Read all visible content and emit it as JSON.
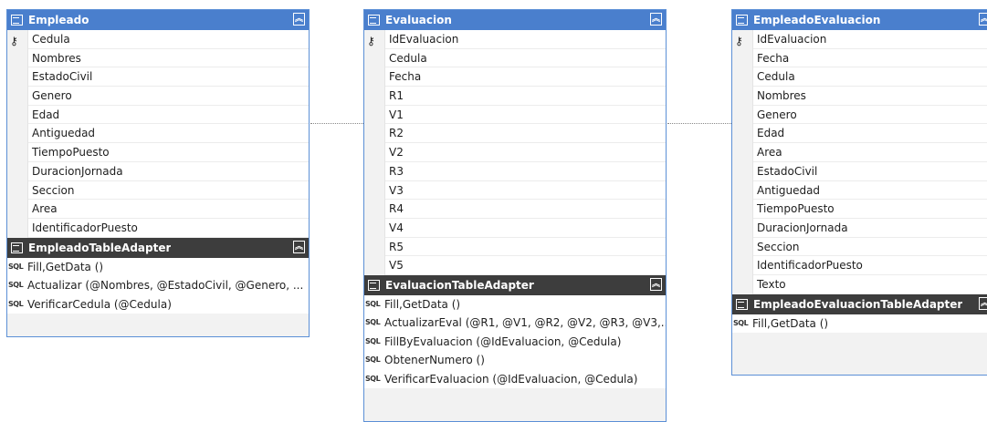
{
  "tables": [
    {
      "name": "Empleado",
      "key": "Cedula",
      "columns": [
        "Nombres",
        "EstadoCivil",
        "Genero",
        "Edad",
        "Antiguedad",
        "TiempoPuesto",
        "DuracionJornada",
        "Seccion",
        "Area",
        "IdentificadorPuesto"
      ],
      "adapter": "EmpleadoTableAdapter",
      "methods": [
        "Fill,GetData ()",
        "Actualizar (@Nombres, @EstadoCivil, @Genero, ...",
        "VerificarCedula (@Cedula)"
      ]
    },
    {
      "name": "Evaluacion",
      "key": "IdEvaluacion",
      "columns": [
        "Cedula",
        "Fecha",
        "R1",
        "V1",
        "R2",
        "V2",
        "R3",
        "V3",
        "R4",
        "V4",
        "R5",
        "V5"
      ],
      "adapter": "EvaluacionTableAdapter",
      "methods": [
        "Fill,GetData ()",
        "ActualizarEval (@R1, @V1, @R2, @V2, @R3, @V3,...",
        "FillByEvaluacion (@IdEvaluacion, @Cedula)",
        "ObtenerNumero ()",
        "VerificarEvaluacion (@IdEvaluacion, @Cedula)"
      ]
    },
    {
      "name": "EmpleadoEvaluacion",
      "key": "IdEvaluacion",
      "columns": [
        "Fecha",
        "Cedula",
        "Nombres",
        "Genero",
        "Edad",
        "Area",
        "EstadoCivil",
        "Antiguedad",
        "TiempoPuesto",
        "DuracionJornada",
        "Seccion",
        "IdentificadorPuesto",
        "Texto"
      ],
      "adapter": "EmpleadoEvaluacionTableAdapter",
      "methods": [
        "Fill,GetData ()"
      ]
    }
  ],
  "icons": {
    "table": "table-icon",
    "adapter": "table-adapter-icon",
    "key": "primary-key-icon",
    "sql": "sql-query-icon",
    "collapse": "collapse-chevron-icon"
  },
  "colors": {
    "table_header": "#4a7fcd",
    "adapter_header": "#3d3d3d",
    "border": "#5b8fd6"
  }
}
